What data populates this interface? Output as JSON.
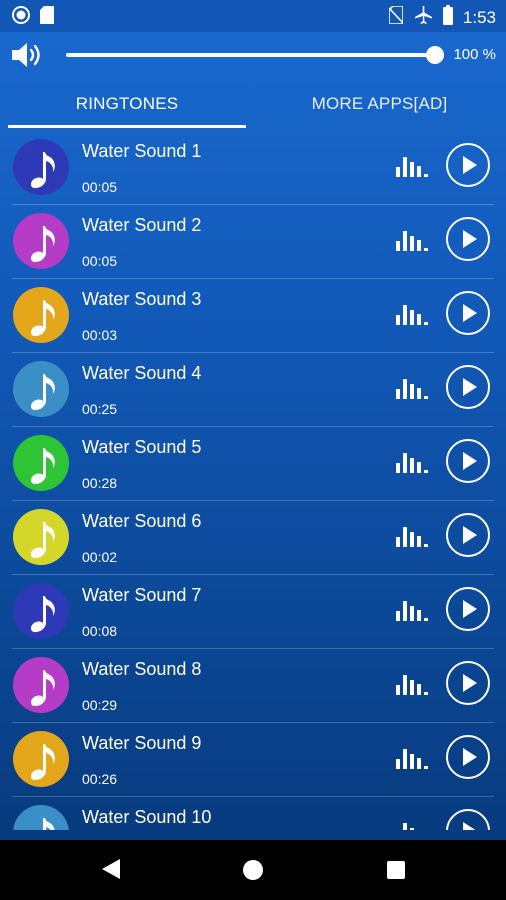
{
  "status_bar": {
    "time": "1:53",
    "icons": [
      "circle-notification-icon",
      "sd-card-icon",
      "no-sim-icon",
      "airplane-icon",
      "battery-icon"
    ]
  },
  "volume": {
    "percent_label": "100 %",
    "level": 1.0
  },
  "tabs": [
    {
      "label": "RINGTONES",
      "selected": true
    },
    {
      "label": "MORE APPS[AD]",
      "selected": false
    }
  ],
  "ringtones": [
    {
      "title": "Water Sound 1",
      "duration": "00:05",
      "color": "#2e39b8"
    },
    {
      "title": "Water Sound 2",
      "duration": "00:05",
      "color": "#b43cc6"
    },
    {
      "title": "Water Sound 3",
      "duration": "00:03",
      "color": "#e4a61a"
    },
    {
      "title": "Water Sound 4",
      "duration": "00:25",
      "color": "#3b8fc7"
    },
    {
      "title": "Water Sound 5",
      "duration": "00:28",
      "color": "#2ec436"
    },
    {
      "title": "Water Sound 6",
      "duration": "00:02",
      "color": "#d4d62a"
    },
    {
      "title": "Water Sound 7",
      "duration": "00:08",
      "color": "#2e39b8"
    },
    {
      "title": "Water Sound 8",
      "duration": "00:29",
      "color": "#b43cc6"
    },
    {
      "title": "Water Sound 9",
      "duration": "00:26",
      "color": "#e4a61a"
    },
    {
      "title": "Water Sound 10",
      "duration": "",
      "color": "#3b8fc7"
    }
  ],
  "colors": {
    "background_top": "#1a6ad0",
    "background_bottom": "#073777",
    "status_bar": "#1257b6",
    "nav_bar": "#000000"
  }
}
